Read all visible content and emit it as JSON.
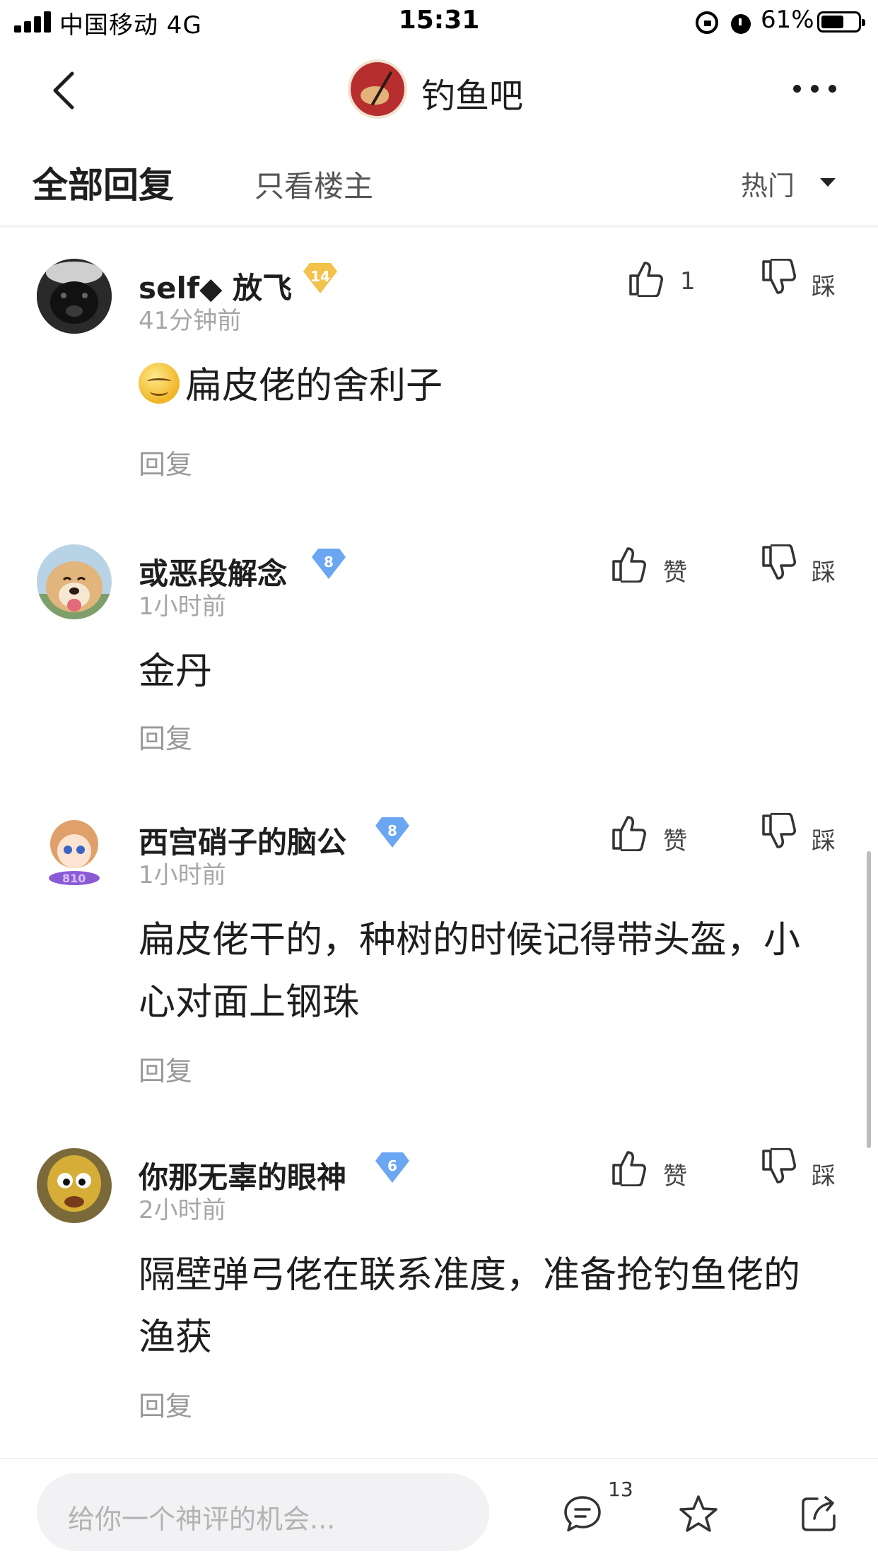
{
  "status_bar": {
    "carrier": "中国移动  4G",
    "time": "15:31",
    "battery": "61%",
    "battery_level": 0.61
  },
  "nav": {
    "forum_name": "钓鱼吧"
  },
  "tabs": {
    "all_replies": "全部回复",
    "op_only": "只看楼主",
    "sort": "热门"
  },
  "comments": [
    {
      "username": "self◆ 放飞",
      "level": "14",
      "time": "41分钟前",
      "like_label": "1",
      "dislike_label": "踩",
      "content": "扁皮佬的舍利子",
      "reply": "回复"
    },
    {
      "username": "或恶段解念",
      "level": "8",
      "time": "1小时前",
      "like_label": "赞",
      "dislike_label": "踩",
      "content": "金丹",
      "reply": "回复"
    },
    {
      "username": "西宫硝子的脑公",
      "level": "8",
      "time": "1小时前",
      "like_label": "赞",
      "dislike_label": "踩",
      "content": "扁皮佬干的，种树的时候记得带头盔，小心对面上钢珠",
      "reply": "回复"
    },
    {
      "username": "你那无辜的眼神",
      "level": "6",
      "time": "2小时前",
      "like_label": "赞",
      "dislike_label": "踩",
      "content": "隔壁弹弓佬在联系准度，准备抢钓鱼佬的渔获",
      "reply": "回复"
    }
  ],
  "bottom_bar": {
    "input_placeholder": "给你一个神评的机会...",
    "comment_count": "13"
  },
  "colors": {
    "badge_gold": "#f2c24a",
    "badge_blue": "#6aa6f2",
    "secondary_text": "#a6a6a6"
  },
  "icons": [
    "back-icon",
    "more-icon",
    "like-icon",
    "dislike-icon",
    "comment-icon",
    "star-icon",
    "share-icon"
  ]
}
